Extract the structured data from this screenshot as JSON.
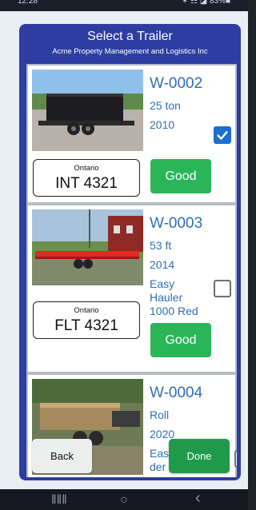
{
  "status": {
    "time": "12:28",
    "icons": "✶ ☷ ◪ 83%■"
  },
  "dialog": {
    "title": "Select a Trailer",
    "subtitle": "Acme Property Management and Logistics Inc"
  },
  "trailers": [
    {
      "id": "W-0002",
      "line1": "25 ton",
      "line2": "2010",
      "line3": "",
      "line4": "",
      "checked": true,
      "plate_province": "Ontario",
      "plate_number": "INT 4321",
      "condition": "Good",
      "condition_color": "#2bb559"
    },
    {
      "id": "W-0003",
      "line1": "53 ft",
      "line2": "2014",
      "line3": "Easy",
      "line4": "Hauler",
      "line5": "1000 Red",
      "checked": false,
      "plate_province": "Ontario",
      "plate_number": "FLT 4321",
      "condition": "Good",
      "condition_color": "#2bb559"
    },
    {
      "id": "W-0004",
      "line1": "Roll",
      "line2": "2020",
      "line3": "Eas",
      "line4": "der",
      "checked": false,
      "plate_province": "",
      "plate_number": "",
      "condition": "",
      "condition_color": "#2bb559"
    }
  ],
  "actions": {
    "back_label": "Back",
    "done_label": "Done"
  },
  "nav": {
    "recents": "‖‖‖",
    "home": "○",
    "back": "‹"
  },
  "colors": {
    "dialog_bg": "#2d3ea0",
    "accent_text": "#2f6fb2",
    "good": "#2bb559",
    "done": "#1f9a4b",
    "checkbox": "#1b6fd0"
  }
}
